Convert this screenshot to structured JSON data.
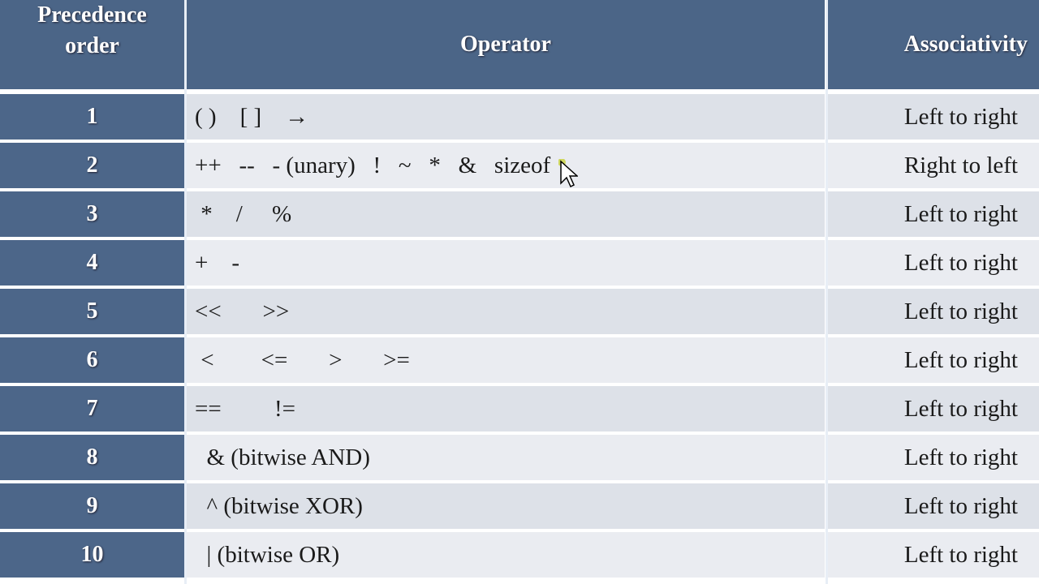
{
  "header": {
    "col1": "Precedence order",
    "col2": "Operator",
    "col3": "Associativity"
  },
  "rows": [
    {
      "order": "1",
      "operator": "( )    [ ]    →",
      "assoc": "Left to right"
    },
    {
      "order": "2",
      "operator": "++   --   - (unary)   !   ~   *   &   sizeof",
      "assoc": "Right to left"
    },
    {
      "order": "3",
      "operator": " *    /     %",
      "assoc": "Left to right"
    },
    {
      "order": "4",
      "operator": "+    -",
      "assoc": "Left to right"
    },
    {
      "order": "5",
      "operator": "<<       >>",
      "assoc": "Left to right"
    },
    {
      "order": "6",
      "operator": " <        <=       >       >=",
      "assoc": "Left to right"
    },
    {
      "order": "7",
      "operator": "==         !=",
      "assoc": "Left to right"
    },
    {
      "order": "8",
      "operator": "  & (bitwise AND)",
      "assoc": "Left to right"
    },
    {
      "order": "9",
      "operator": "  ^ (bitwise XOR)",
      "assoc": "Left to right"
    },
    {
      "order": "10",
      "operator": "  | (bitwise OR)",
      "assoc": "Left to right"
    }
  ]
}
